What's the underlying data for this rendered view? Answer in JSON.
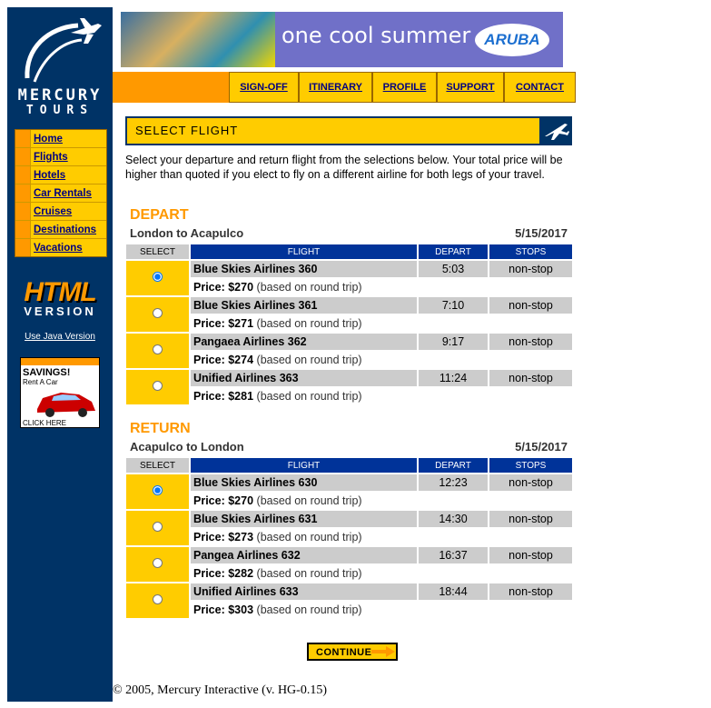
{
  "sidebar": {
    "brand_line1": "MERCURY",
    "brand_line2": "TOURS",
    "items": [
      {
        "label": "Home"
      },
      {
        "label": "Flights"
      },
      {
        "label": "Hotels"
      },
      {
        "label": "Car Rentals"
      },
      {
        "label": "Cruises"
      },
      {
        "label": "Destinations"
      },
      {
        "label": "Vacations"
      }
    ],
    "html_version_big": "HTML",
    "html_version_small": "VERSION",
    "java_link": "Use Java Version",
    "ad": {
      "headline": "SAVINGS!",
      "subline": "Rent A Car",
      "cta": "CLICK HERE"
    }
  },
  "banner": {
    "slogan": "one cool summer",
    "logo": "ARUBA"
  },
  "topnav": [
    "SIGN-OFF",
    "ITINERARY",
    "PROFILE",
    "SUPPORT",
    "CONTACT"
  ],
  "section_title": "SELECT FLIGHT",
  "description": "Select your departure and return flight from the selections below. Your total price will be higher than quoted if you elect to fly on a different airline for both legs of your travel.",
  "columns": {
    "select": "SELECT",
    "flight": "FLIGHT",
    "depart": "DEPART",
    "stops": "STOPS"
  },
  "price_prefix": "Price:",
  "price_suffix": "(based on round trip)",
  "depart": {
    "heading": "DEPART",
    "route": "London to Acapulco",
    "date": "5/15/2017",
    "flights": [
      {
        "name": "Blue Skies Airlines 360",
        "time": "5:03",
        "stops": "non-stop",
        "price": "$270",
        "selected": true
      },
      {
        "name": "Blue Skies Airlines 361",
        "time": "7:10",
        "stops": "non-stop",
        "price": "$271",
        "selected": false
      },
      {
        "name": "Pangaea Airlines 362",
        "time": "9:17",
        "stops": "non-stop",
        "price": "$274",
        "selected": false
      },
      {
        "name": "Unified Airlines 363",
        "time": "11:24",
        "stops": "non-stop",
        "price": "$281",
        "selected": false
      }
    ]
  },
  "return": {
    "heading": "RETURN",
    "route": "Acapulco to London",
    "date": "5/15/2017",
    "flights": [
      {
        "name": "Blue Skies Airlines 630",
        "time": "12:23",
        "stops": "non-stop",
        "price": "$270",
        "selected": true
      },
      {
        "name": "Blue Skies Airlines 631",
        "time": "14:30",
        "stops": "non-stop",
        "price": "$273",
        "selected": false
      },
      {
        "name": "Pangea Airlines 632",
        "time": "16:37",
        "stops": "non-stop",
        "price": "$282",
        "selected": false
      },
      {
        "name": "Unified Airlines 633",
        "time": "18:44",
        "stops": "non-stop",
        "price": "$303",
        "selected": false
      }
    ]
  },
  "continue_label": "CONTINUE",
  "footer": "© 2005, Mercury Interactive (v. HG-0.15)"
}
